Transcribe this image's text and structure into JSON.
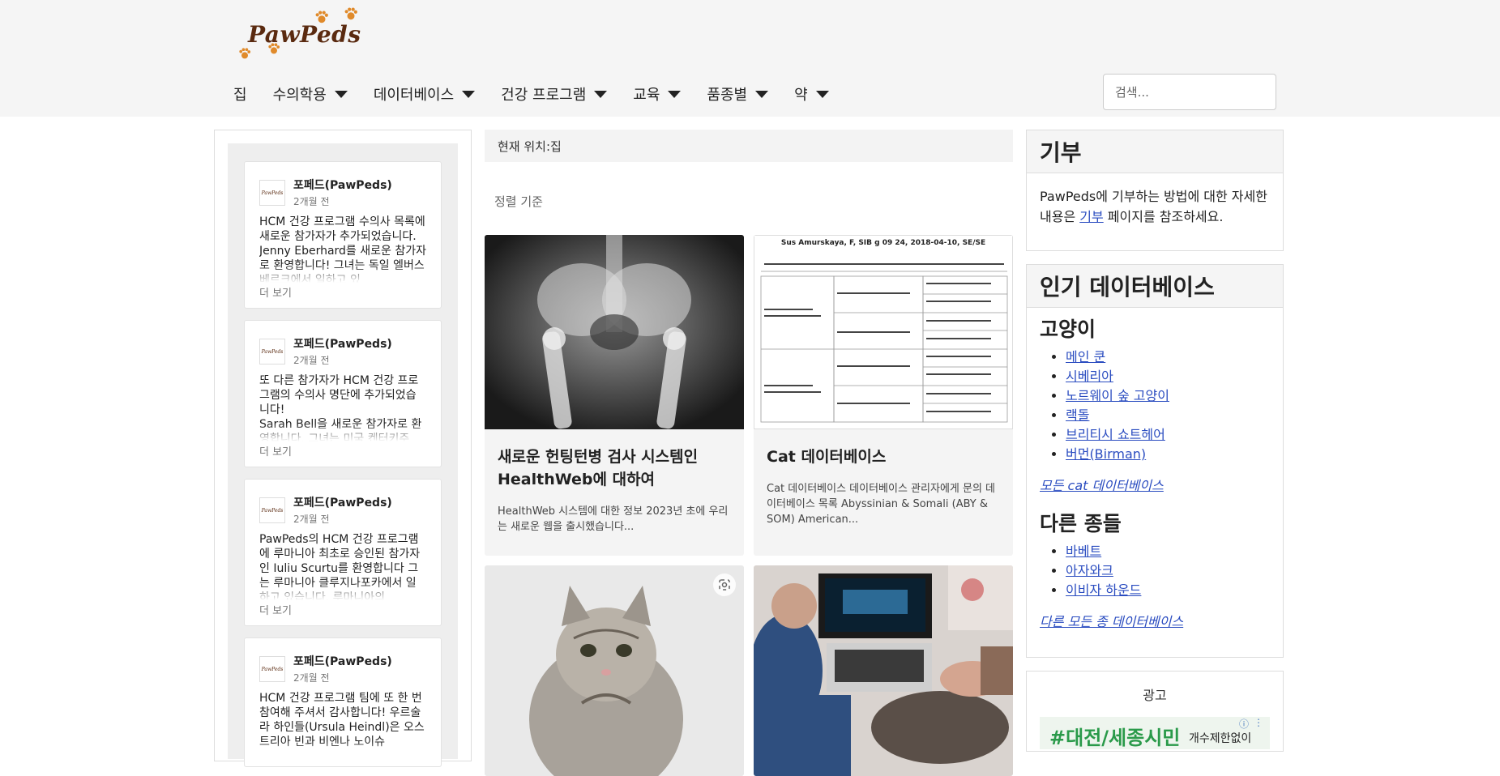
{
  "site": {
    "logo_text": "PawPeds",
    "search_placeholder": "검색..."
  },
  "nav": {
    "items": [
      {
        "label": "집",
        "dropdown": false
      },
      {
        "label": "수의학용",
        "dropdown": true
      },
      {
        "label": "데이터베이스",
        "dropdown": true
      },
      {
        "label": "건강 프로그램",
        "dropdown": true
      },
      {
        "label": "교육",
        "dropdown": true
      },
      {
        "label": "품종별",
        "dropdown": true
      },
      {
        "label": "약",
        "dropdown": true
      }
    ]
  },
  "feed": {
    "posts": [
      {
        "author": "포페드(PawPeds)",
        "time": "2개월 전",
        "avatar": "PawPeds",
        "text": "HCM 건강 프로그램 수의사 목록에 새로운 참가자가 추가되었습니다. Jenny Eberhard를 새로운 참가자로 환영합니다! 그녀는 독일 엘버스베르크에서 일하고 있",
        "more": "더 보기"
      },
      {
        "author": "포페드(PawPeds)",
        "time": "2개월 전",
        "avatar": "PawPeds",
        "text": "또 다른 참가자가 HCM 건강 프로그램의 수의사 명단에 추가되었습니다!\nSarah Bell을 새로운 참가자로 환영합니다. 그녀는 미국 켄터키주",
        "more": "더 보기"
      },
      {
        "author": "포페드(PawPeds)",
        "time": "2개월 전",
        "avatar": "PawPeds",
        "text": "PawPeds의 HCM 건강 프로그램에 루마니아 최초로 승인된 참가자인 Iuliu Scurtu를 환영합니다 그는 루마니아 클루지나포카에서 일하고 있습니다. 루마니아의",
        "more": "더 보기"
      },
      {
        "author": "포페드(PawPeds)",
        "time": "2개월 전",
        "avatar": "PawPeds",
        "text": "HCM 건강 프로그램 팀에 또 한 번 참여해 주셔서 감사합니다! 우르술라 하인들(Ursula Heindl)은 오스트리아 빈과 비엔나 노이슈",
        "more": ""
      }
    ]
  },
  "main": {
    "breadcrumb": "현재 위치:집",
    "sort_label": "정렬 기준",
    "cards": [
      {
        "title": "새로운 헌팅턴병 검사 시스템인 HealthWeb에 대하여",
        "text": "HealthWeb 시스템에 대한 정보 2023년 초에 우리는 새로운 웹을 출시했습니다...",
        "image": "xray"
      },
      {
        "title": "Cat 데이터베이스",
        "text": "Cat 데이터베이스 데이터베이스 관리자에게 문의 데이터베이스 목록 Abyssinian & Somali (ABY & SOM) American...",
        "image": "pedigree",
        "pedigree_heading": "Sus Amurskaya, F, SIB g 09 24, 2018-04-10, SE/SE"
      },
      {
        "title": "",
        "text": "",
        "image": "kitten"
      },
      {
        "title": "",
        "text": "",
        "image": "ultrasound"
      }
    ]
  },
  "sidebar": {
    "donate": {
      "title": "기부",
      "text_before": "PawPeds에 기부하는 방법에 대한 자세한 내용은 ",
      "link": "기부",
      "text_after": " 페이지를 참조하세요."
    },
    "popular": {
      "title": "인기 데이터베이스",
      "cats_heading": "고양이",
      "cats": [
        "메인 쿤",
        "시베리아",
        "노르웨이 숲 고양이",
        "랙돌",
        "브리티시 쇼트헤어",
        "버먼(Birman)"
      ],
      "all_cats": "모든 cat 데이터베이스",
      "other_heading": "다른 종들",
      "others": [
        "바베트",
        "아자와크",
        "이비자 하운드"
      ],
      "all_others": "다른 모든 종 데이터베이스"
    },
    "ad": {
      "label": "광고",
      "banner_text": "#대전/세종시민",
      "banner_small": "개수제한없이"
    }
  },
  "colors": {
    "header_bg": "#f5f5f5",
    "link": "#2a4cc0",
    "logo_brown": "#5a2a10",
    "paw_orange": "#e08a2a"
  }
}
